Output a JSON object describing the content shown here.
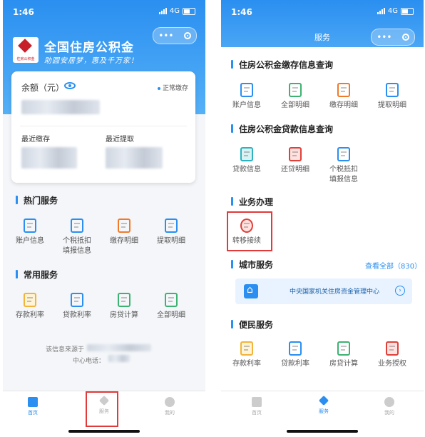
{
  "left": {
    "status": {
      "time": "1:46",
      "network": "4G"
    },
    "brand": {
      "title": "全国住房公积金",
      "slogan": "助圆安居梦，惠及千万家！",
      "logo_caption": "住房公积金"
    },
    "card": {
      "balance_label": "余额（元）",
      "status": "正常缴存",
      "last_deposit": "最近缴存",
      "last_withdraw": "最近提取"
    },
    "hot": {
      "title": "热门服务",
      "items": [
        "账户信息",
        "个税抵扣\n填报信息",
        "缴存明细",
        "提取明细"
      ]
    },
    "common": {
      "title": "常用服务",
      "items": [
        "存款利率",
        "贷款利率",
        "房贷计算",
        "全部明细"
      ]
    },
    "footnote": {
      "source": "该信息来源于",
      "phone": "中心电话："
    },
    "tabs": [
      "首页",
      "服务",
      "我的"
    ]
  },
  "right": {
    "status": {
      "time": "1:46",
      "network": "4G"
    },
    "title": "服务",
    "deposit": {
      "title": "住房公积金缴存信息查询",
      "items": [
        "账户信息",
        "全部明细",
        "缴存明细",
        "提取明细"
      ]
    },
    "loan": {
      "title": "住房公积金贷款信息查询",
      "items": [
        "贷款信息",
        "还贷明细",
        "个税抵扣\n填报信息"
      ]
    },
    "biz": {
      "title": "业务办理",
      "items": [
        "转移接续"
      ]
    },
    "city": {
      "title": "城市服务",
      "view_all": "查看全部（830）",
      "center": "中央国家机关住房资金管理中心"
    },
    "convenience": {
      "title": "便民服务",
      "items": [
        "存款利率",
        "贷款利率",
        "房贷计算",
        "业务授权"
      ]
    },
    "tabs": [
      "首页",
      "服务",
      "我的"
    ]
  }
}
